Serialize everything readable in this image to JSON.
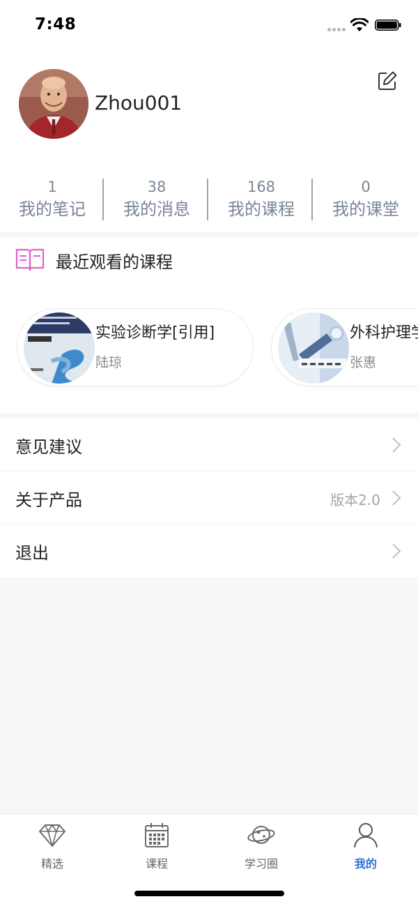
{
  "status_bar": {
    "time": "7:48"
  },
  "profile": {
    "username": "Zhou001"
  },
  "stats": [
    {
      "count": "1",
      "label": "我的笔记"
    },
    {
      "count": "38",
      "label": "我的消息"
    },
    {
      "count": "168",
      "label": "我的课程"
    },
    {
      "count": "0",
      "label": "我的课堂"
    }
  ],
  "recent": {
    "title": "最近观看的课程",
    "courses": [
      {
        "title": "实验诊断学[引用]",
        "teacher": "陆琼"
      },
      {
        "title": "外科护理学",
        "teacher": "张惠"
      }
    ]
  },
  "menu": [
    {
      "label": "意见建议",
      "value": ""
    },
    {
      "label": "关于产品",
      "value": "版本2.0"
    },
    {
      "label": "退出",
      "value": ""
    }
  ],
  "tabbar": {
    "items": [
      {
        "label": "精选",
        "icon": "diamond-icon"
      },
      {
        "label": "课程",
        "icon": "calendar-icon"
      },
      {
        "label": "学习圈",
        "icon": "planet-icon"
      },
      {
        "label": "我的",
        "icon": "user-icon"
      }
    ],
    "active_index": 3
  },
  "colors": {
    "accent": "#2f6fd6",
    "muted": "#7a8596",
    "recent_icon": "#e05fd2"
  }
}
